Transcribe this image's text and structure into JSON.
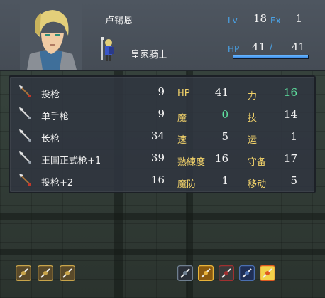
{
  "unit": {
    "name": "卢锡恩",
    "class_name": "皇家骑士",
    "lv_label": "Lv",
    "lv": "18",
    "ex_label": "Ex",
    "ex": "1",
    "hp_label": "HP",
    "hp_current": "41",
    "hp_separator": "/",
    "hp_max": "41",
    "hp_fraction": 1.0
  },
  "inventory": [
    {
      "name": "投枪",
      "uses": "9",
      "icon": "javelin-icon"
    },
    {
      "name": "单手枪",
      "uses": "9",
      "icon": "lance-icon"
    },
    {
      "name": "长枪",
      "uses": "34",
      "icon": "lance-icon"
    },
    {
      "name": "王国正式枪+1",
      "uses": "39",
      "icon": "lance-icon"
    },
    {
      "name": "投枪+2",
      "uses": "16",
      "icon": "javelin-icon"
    }
  ],
  "stats_left": [
    {
      "label": "HP",
      "value": "41"
    },
    {
      "label": "魔",
      "value": "0"
    },
    {
      "label": "速",
      "value": "5"
    },
    {
      "label": "熟練度",
      "value": "16"
    },
    {
      "label": "魔防",
      "value": "1"
    }
  ],
  "stats_right": [
    {
      "label": "力",
      "value": "16"
    },
    {
      "label": "技",
      "value": "14"
    },
    {
      "label": "运",
      "value": "1"
    },
    {
      "label": "守备",
      "value": "17"
    },
    {
      "label": "移动",
      "value": "5"
    }
  ],
  "skills_left": [
    "sword-skill-icon",
    "lance-skill-icon",
    "swap-skill-icon"
  ],
  "skills_right": [
    "armor-skill-icon",
    "sun-emblem-icon",
    "crossed-swords-icon",
    "shield-icon",
    "burst-icon"
  ],
  "colors": {
    "stat_label": "#f3d36a",
    "highlight_value": "#5fe3a0",
    "blue_label": "#4aa3e8",
    "hp_bar": "#2d7fe0"
  }
}
